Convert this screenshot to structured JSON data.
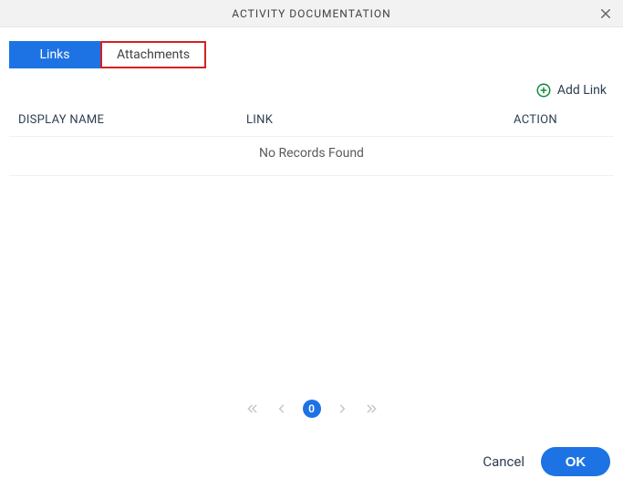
{
  "header": {
    "title": "ACTIVITY DOCUMENTATION"
  },
  "tabs": {
    "links": "Links",
    "attachments": "Attachments"
  },
  "add_link": {
    "label": "Add Link"
  },
  "columns": {
    "display_name": "DISPLAY NAME",
    "link": "LINK",
    "action": "ACTION"
  },
  "empty_msg": "No Records Found",
  "pagination": {
    "current": "0"
  },
  "footer": {
    "cancel": "Cancel",
    "ok": "OK"
  }
}
